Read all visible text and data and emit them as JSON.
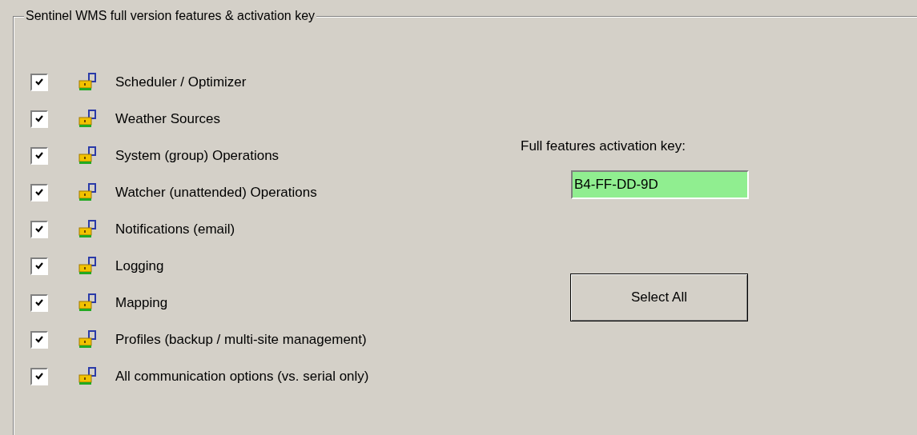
{
  "group": {
    "title": "Sentinel WMS full version features & activation key"
  },
  "features": [
    {
      "label": "Scheduler / Optimizer",
      "checked": true
    },
    {
      "label": "Weather Sources",
      "checked": true
    },
    {
      "label": "System (group) Operations",
      "checked": true
    },
    {
      "label": "Watcher (unattended) Operations",
      "checked": true
    },
    {
      "label": "Notifications (email)",
      "checked": true
    },
    {
      "label": "Logging",
      "checked": true
    },
    {
      "label": "Mapping",
      "checked": true
    },
    {
      "label": "Profiles (backup / multi-site management)",
      "checked": true
    },
    {
      "label": "All communication options (vs. serial only)",
      "checked": true
    }
  ],
  "activation": {
    "label": "Full features activation key:",
    "value": "B4-FF-DD-9D"
  },
  "buttons": [
    {
      "label": "Select All"
    }
  ]
}
